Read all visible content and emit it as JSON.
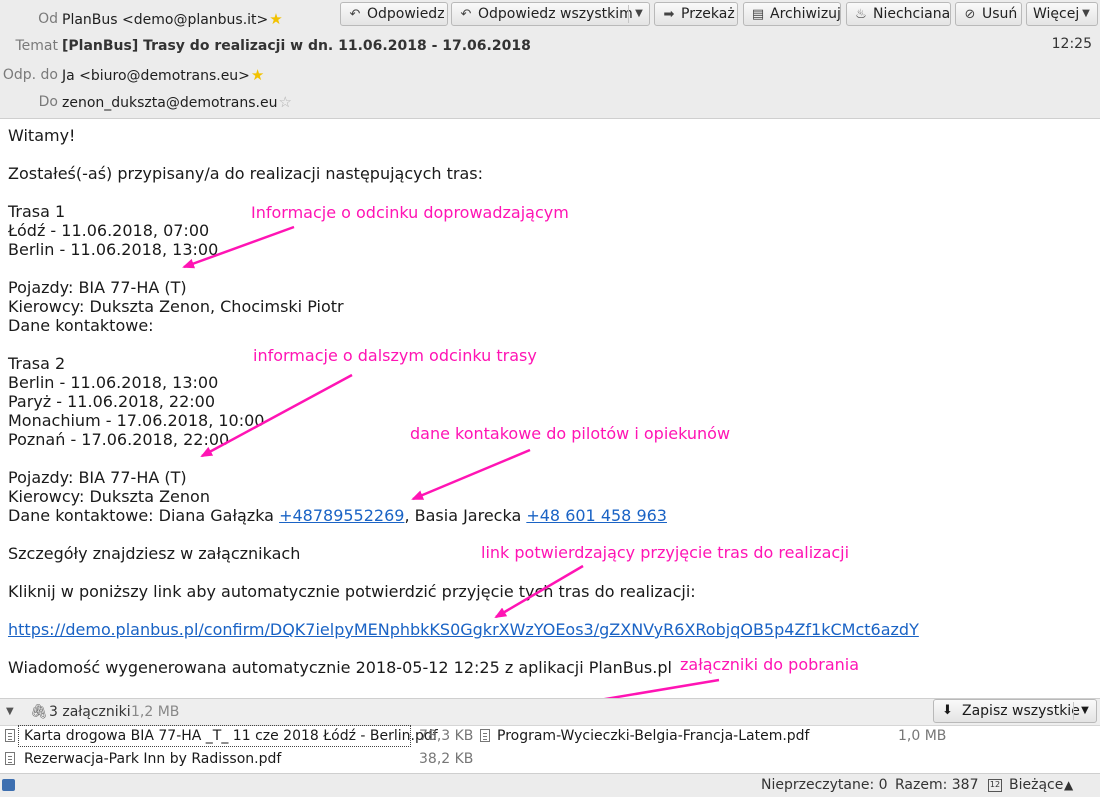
{
  "header": {
    "from_label": "Od",
    "from_value": "PlanBus <demo@planbus.it>",
    "subject_label": "Temat",
    "subject_value": "[PlanBus] Trasy do realizacji w dn. 11.06.2018 - 17.06.2018",
    "time": "12:25",
    "reply_to_label": "Odp. do",
    "reply_to_value": "Ja <biuro@demotrans.eu>",
    "to_label": "Do",
    "to_value": "zenon_dukszta@demotrans.eu"
  },
  "toolbar": {
    "reply": "Odpowiedz",
    "reply_all": "Odpowiedz wszystkim",
    "forward": "Przekaż",
    "archive": "Archiwizuj",
    "junk": "Niechciana",
    "delete": "Usuń",
    "more": "Więcej"
  },
  "body": {
    "greeting": "Witamy!",
    "intro": "Zostałeś(-aś) przypisany/a do realizacji następujących tras:",
    "route1": {
      "title": "Trasa 1",
      "stops": [
        "Łódź - 11.06.2018, 07:00",
        "Berlin - 11.06.2018, 13:00"
      ],
      "vehicles": "Pojazdy: BIA 77-HA (T)",
      "drivers": "Kierowcy: Dukszta Zenon, Chocimski Piotr",
      "contacts": "Dane kontaktowe:"
    },
    "route2": {
      "title": "Trasa 2",
      "stops": [
        "Berlin - 11.06.2018, 13:00",
        "Paryż - 11.06.2018, 22:00",
        "Monachium - 17.06.2018, 10:00",
        "Poznań - 17.06.2018, 22:00"
      ],
      "vehicles": "Pojazdy: BIA 77-HA (T)",
      "drivers": "Kierowcy: Dukszta Zenon",
      "contacts_prefix": "Dane kontaktowe: Diana Gałązka ",
      "phone1": "+48789552269",
      "contacts_mid": ", Basia Jarecka ",
      "phone2": "+48 601 458 963"
    },
    "details": "Szczegóły znajdziesz w załącznikach",
    "click_info": "Kliknij w poniższy link aby automatycznie potwierdzić przyjęcie tych tras do realizacji:",
    "confirm_link": "https://demo.planbus.pl/confirm/DQK7ielpyMENphbkKS0GgkrXWzYOEos3/gZXNVyR6XRobjqOB5p4Zf1kCMct6azdY",
    "footer": "Wiadomość wygenerowana automatycznie 2018-05-12 12:25 z aplikacji PlanBus.pl"
  },
  "annotations": {
    "a1": "Informacje o odcinku doprowadzającym",
    "a2": "informacje o dalszym odcinku trasy",
    "a3": "dane kontakowe do pilotów i opiekunów",
    "a4": "link potwierdzający przyjęcie tras do realizacji",
    "a5": "załączniki do pobrania",
    "color": "#ff14b4"
  },
  "attachments": {
    "count_label": "3 załączniki",
    "total_size": "1,2 MB",
    "save_all": "Zapisz wszystkie",
    "items": [
      {
        "name": "Karta drogowa BIA 77-HA _T_ 11 cze 2018 Łódź - Berlin.pdf",
        "size": "78,3 KB"
      },
      {
        "name": "Program-Wycieczki-Belgia-Francja-Latem.pdf",
        "size": "1,0 MB"
      },
      {
        "name": "Rezerwacja-Park Inn by Radisson.pdf",
        "size": "38,2 KB"
      }
    ]
  },
  "statusbar": {
    "unread": "Nieprzeczytane: 0",
    "total": "Razem: 387",
    "calendar_day": "12",
    "current": "Bieżące"
  },
  "colors": {
    "link": "#1a63c5",
    "annotation": "#ff14b4",
    "header_bg": "#ececec"
  }
}
